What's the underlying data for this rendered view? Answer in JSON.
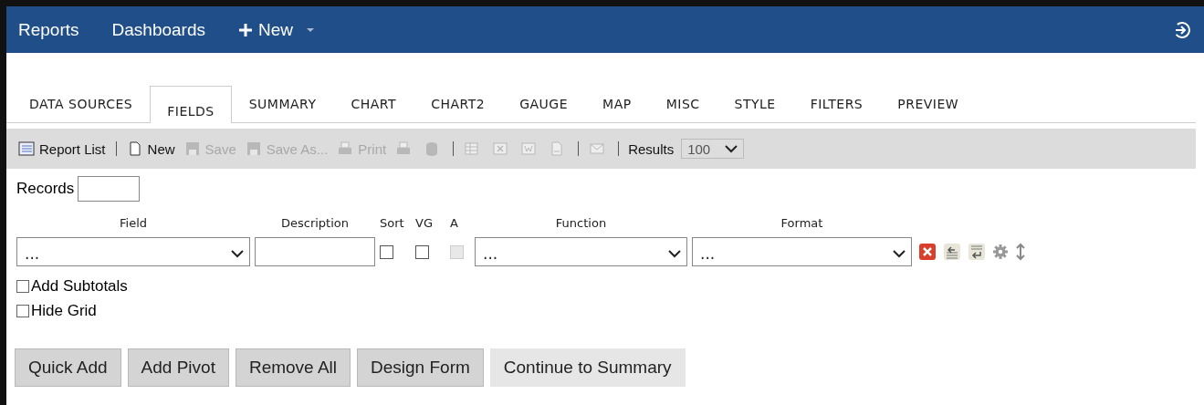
{
  "nav": {
    "items": [
      {
        "label": "Reports"
      },
      {
        "label": "Dashboards"
      }
    ],
    "new_button": {
      "label": "New"
    }
  },
  "tabs": [
    {
      "label": "DATA SOURCES",
      "selected": false
    },
    {
      "label": "FIELDS",
      "selected": true
    },
    {
      "label": "SUMMARY",
      "selected": false
    },
    {
      "label": "CHART",
      "selected": false
    },
    {
      "label": "CHART2",
      "selected": false
    },
    {
      "label": "GAUGE",
      "selected": false
    },
    {
      "label": "MAP",
      "selected": false
    },
    {
      "label": "MISC",
      "selected": false
    },
    {
      "label": "STYLE",
      "selected": false
    },
    {
      "label": "FILTERS",
      "selected": false
    },
    {
      "label": "PREVIEW",
      "selected": false
    }
  ],
  "toolbar": [
    {
      "kind": "labeled",
      "label": "Report List",
      "disabled": false
    },
    {
      "kind": "separator"
    },
    {
      "kind": "labeled",
      "label": "New",
      "disabled": false
    },
    {
      "kind": "labeled",
      "label": "Save",
      "disabled": true
    },
    {
      "kind": "labeled",
      "label": "Save As...",
      "disabled": true
    },
    {
      "kind": "labeled",
      "label": "Print",
      "disabled": true
    },
    {
      "kind": "icon",
      "disabled": true
    },
    {
      "kind": "icon",
      "disabled": true
    },
    {
      "kind": "separator"
    },
    {
      "kind": "icon",
      "disabled": true
    },
    {
      "kind": "icon",
      "disabled": true
    },
    {
      "kind": "icon",
      "disabled": true
    },
    {
      "kind": "icon",
      "disabled": true
    },
    {
      "kind": "separator"
    },
    {
      "kind": "icon",
      "disabled": true
    },
    {
      "kind": "separator"
    },
    {
      "kind": "text",
      "label": "Results"
    },
    {
      "kind": "select",
      "value": "100"
    }
  ],
  "records": {
    "label": "Records"
  },
  "field_grid": {
    "columns": [
      {
        "label": "Field"
      },
      {
        "label": "Description"
      },
      {
        "label": "Sort"
      },
      {
        "label": "VG"
      },
      {
        "label": "A"
      },
      {
        "label": "Function"
      },
      {
        "label": "Format"
      }
    ],
    "row": {
      "field": "...",
      "sort": false,
      "vg": false,
      "a_disabled": true,
      "function": "...",
      "format": "..."
    }
  },
  "options": [
    {
      "label": "Add Subtotals",
      "checked": false
    },
    {
      "label": "Hide Grid",
      "checked": false
    }
  ],
  "buttons": [
    {
      "label": "Quick Add",
      "kind": "standard"
    },
    {
      "label": "Add Pivot",
      "kind": "standard"
    },
    {
      "label": "Remove All",
      "kind": "standard"
    },
    {
      "label": "Design Form",
      "kind": "standard"
    },
    {
      "label": "Continue to Summary",
      "kind": "light"
    }
  ]
}
